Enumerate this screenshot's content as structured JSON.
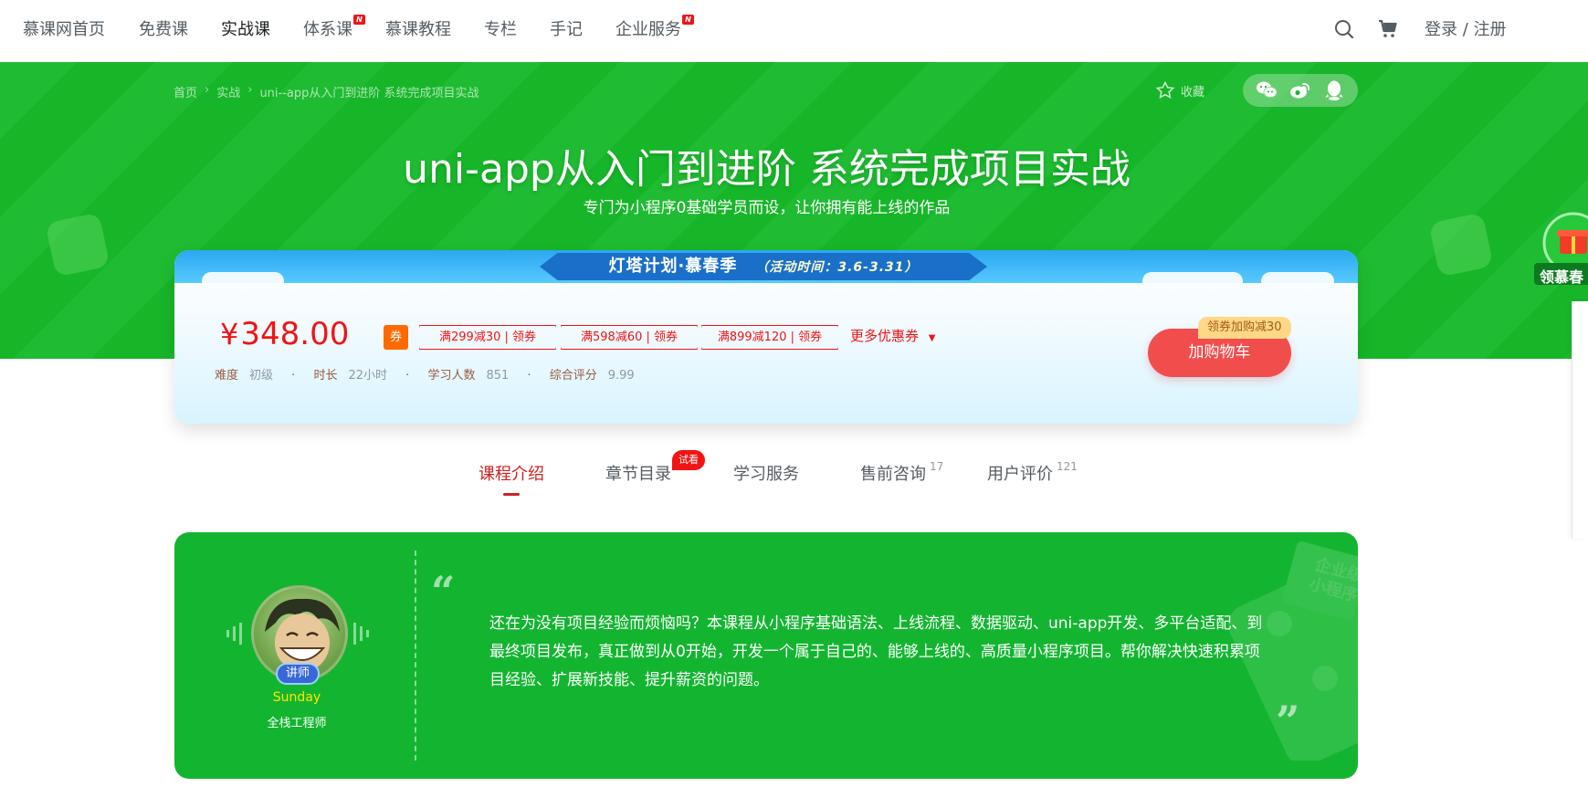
{
  "nav": {
    "items": [
      {
        "label": "慕课网首页"
      },
      {
        "label": "免费课"
      },
      {
        "label": "实战课"
      },
      {
        "label": "体系课",
        "badge": "N"
      },
      {
        "label": "慕课教程"
      },
      {
        "label": "专栏"
      },
      {
        "label": "手记"
      },
      {
        "label": "企业服务",
        "badge": "N"
      }
    ],
    "login_text": "登录 / 注册",
    "icons": [
      "search-icon",
      "cart-icon"
    ]
  },
  "breadcrumb": [
    "首页",
    "实战",
    "uni--app从入门到进阶 系统完成项目实战"
  ],
  "favorite_label": "收藏",
  "share_icons": [
    "wechat-icon",
    "weibo-icon",
    "qq-icon"
  ],
  "course": {
    "title": "uni-app从入门到进阶 系统完成项目实战",
    "subtitle": "专门为小程序0基础学员而设，让你拥有能上线的作品"
  },
  "side_promo": {
    "label": "领慕春"
  },
  "promo": {
    "title": "灯塔计划·慕春季",
    "period": "（活动时间：3.6-3.31）"
  },
  "pricing": {
    "currency": "¥",
    "price": "348.00",
    "coupon_tag": "券",
    "coupons": [
      "满299减30 | 领券",
      "满598减60 | 领券",
      "满899减120 | 领券"
    ],
    "more_coupons": "更多优惠券",
    "meta": [
      {
        "key": "难度",
        "value": "初级"
      },
      {
        "key": "时长",
        "value": "22小时"
      },
      {
        "key": "学习人数",
        "value": "851"
      },
      {
        "key": "综合评分",
        "value": "9.99"
      }
    ],
    "cart_button": "加购物车",
    "cart_tip": "领券加购减30"
  },
  "tabs": [
    {
      "label": "课程介绍",
      "active": true
    },
    {
      "label": "章节目录",
      "badge": "试看"
    },
    {
      "label": "学习服务"
    },
    {
      "label": "售前咨询",
      "count": "17"
    },
    {
      "label": "用户评价",
      "count": "121"
    }
  ],
  "intro": {
    "lecturer_badge": "讲师",
    "name": "Sunday",
    "title": "全栈工程师",
    "text": "还在为没有项目经验而烦恼吗？本课程从小程序基础语法、上线流程、数据驱动、uni-app开发、多平台适配、到最终项目发布，真正做到从0开始，开发一个属于自己的、能够上线的、高质量小程序项目。帮你解决快速积累项目经验、扩展新技能、提升薪资的问题。",
    "deco_text": "企业级小程序"
  },
  "colors": {
    "brand_green": "#17b92a",
    "accent_red": "#f01414",
    "cart_red": "#f24d4d"
  }
}
